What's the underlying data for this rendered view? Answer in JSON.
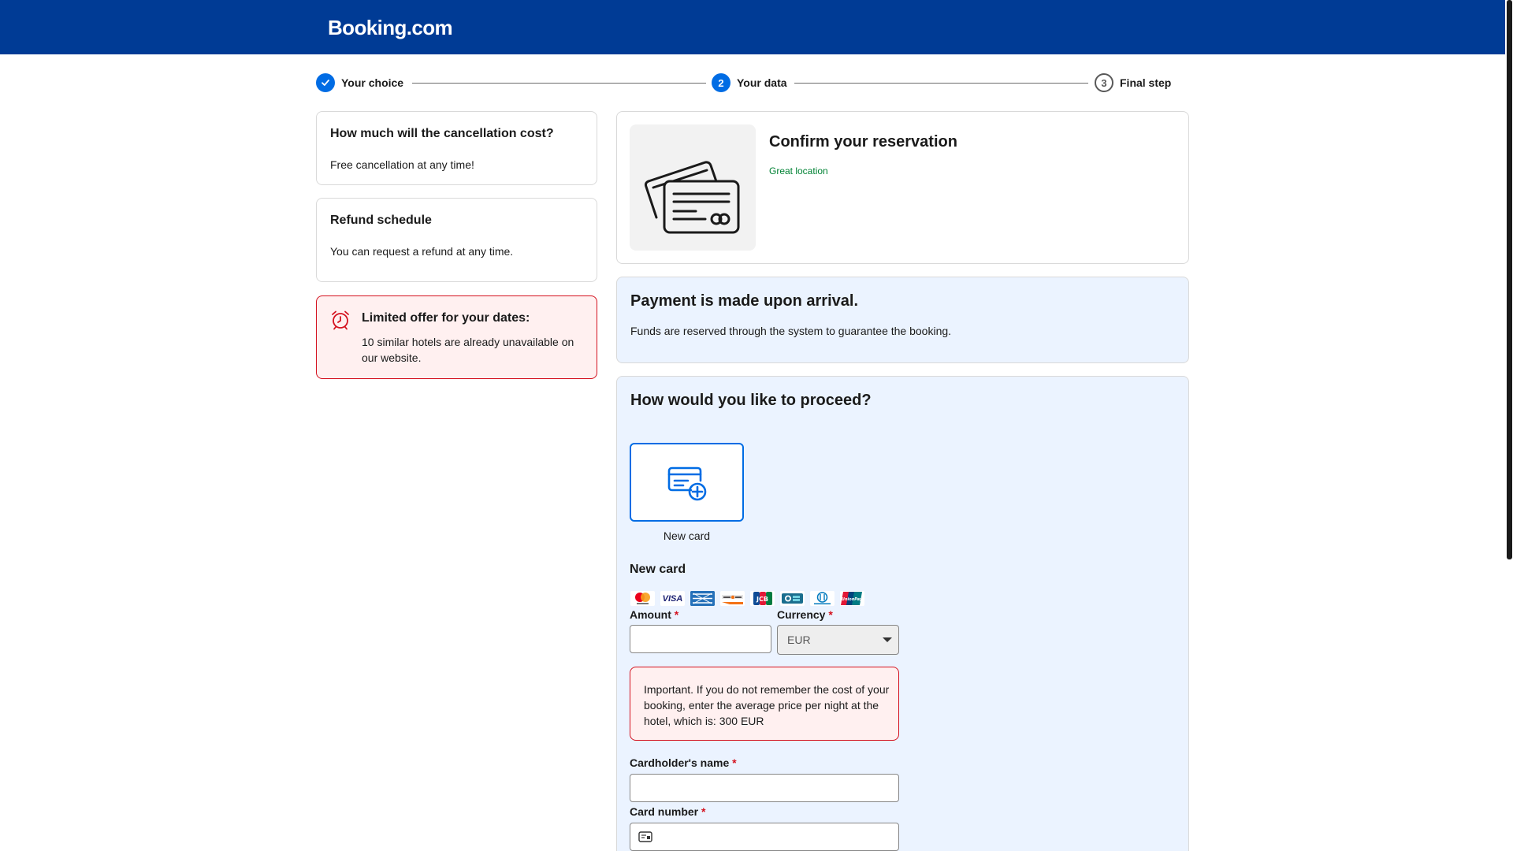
{
  "brand": {
    "name": "Booking.com",
    "header_color": "#003b95"
  },
  "steps": [
    {
      "label": "Your choice",
      "marker": "",
      "state": "done"
    },
    {
      "label": "Your data",
      "marker": "2",
      "state": "active"
    },
    {
      "label": "Final step",
      "marker": "3",
      "state": "todo"
    }
  ],
  "cancellation": {
    "title": "How much will the cancellation cost?",
    "text": "Free cancellation at any time!"
  },
  "refund": {
    "title": "Refund schedule",
    "text": "You can request a refund at any time."
  },
  "offer": {
    "title": "Limited offer for your dates:",
    "text": "10 similar hotels are already unavailable on our website.",
    "icon": "alarm-clock-icon"
  },
  "reservation": {
    "title": "Confirm your reservation",
    "tag": "Great location",
    "image_icon": "credit-cards-icon"
  },
  "payment_info": {
    "title": "Payment is made upon arrival.",
    "text": "Funds are reserved through the system to guarantee the booking."
  },
  "proceed": {
    "title": "How would you like to proceed?",
    "option_label": "New card",
    "option_icon": "add-card-icon",
    "section_title": "New card",
    "card_brands": [
      "mastercard",
      "visa",
      "amex",
      "discover",
      "jcb",
      "cartes-bancaires",
      "diners-club",
      "unionpay"
    ]
  },
  "form": {
    "amount_label": "Amount",
    "amount_value": "",
    "currency_label": "Currency",
    "currency_value": "EUR",
    "required_mark": "*",
    "notice": "Important. If you do not remember the cost of your booking, enter the average price per night at the hotel, which is: 300 EUR",
    "cardholder_label": "Cardholder's name",
    "cardholder_value": "",
    "card_number_label": "Card number",
    "card_number_value": ""
  },
  "colors": {
    "accent": "#006ce4",
    "success_text": "#008234",
    "danger": "#d4111e",
    "panel_blue": "#ebf3ff"
  }
}
